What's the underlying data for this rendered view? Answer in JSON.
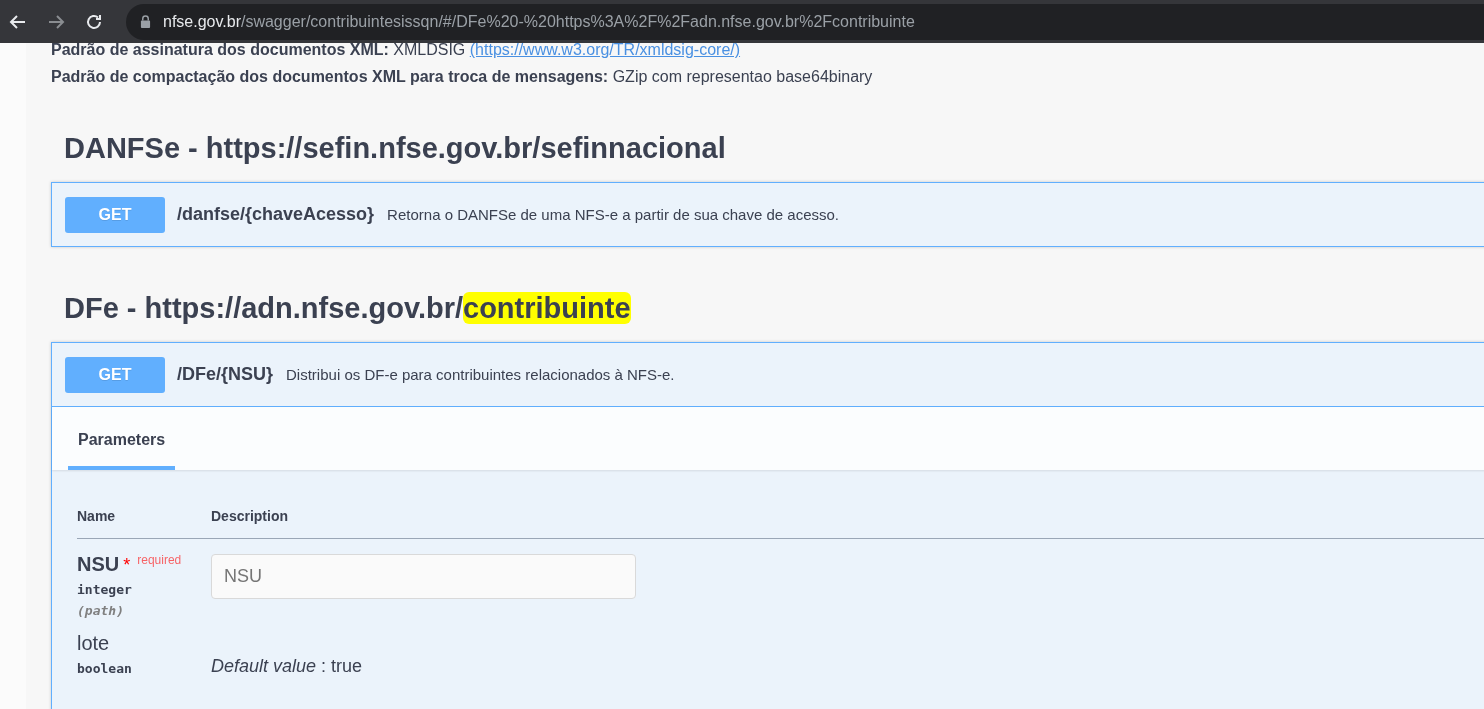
{
  "browser": {
    "url_host": "nfse.gov.br",
    "url_path": "/swagger/contribuintesissqn/#/DFe%20-%20https%3A%2F%2Fadn.nfse.gov.br%2Fcontribuinte"
  },
  "info": [
    {
      "label": "Padrão de assinatura dos documentos XML:",
      "value": "XMLDSIG",
      "link": "(https://www.w3.org/TR/xmldsig-core/)"
    },
    {
      "label": "Padrão de compactação dos documentos XML para troca de mensagens:",
      "value": "GZip com representao base64binary"
    }
  ],
  "sections": [
    {
      "title": "DANFSe - https://sefin.nfse.gov.br/sefinnacional",
      "operations": [
        {
          "method": "GET",
          "path": "/danfse/{chaveAcesso}",
          "summary": "Retorna o DANFSe de uma NFS-e a partir de sua chave de acesso.",
          "expanded": false
        }
      ]
    },
    {
      "title": "DFe - https://adn.nfse.gov.br/",
      "highlight": "contribuinte",
      "operations": [
        {
          "method": "GET",
          "path": "/DFe/{NSU}",
          "summary": "Distribui os DF-e para contribuintes relacionados à NFS-e.",
          "expanded": true,
          "tabs": [
            {
              "label": "Parameters",
              "selected": true
            }
          ],
          "columns": [
            "Name",
            "Description"
          ],
          "parameters": [
            {
              "name": "NSU",
              "required": true,
              "required_mark": "*",
              "required_label": "required",
              "type": "integer",
              "in": "(path)",
              "placeholder": "NSU"
            },
            {
              "name": "lote",
              "required": false,
              "type": "boolean",
              "default_label": "Default value",
              "default_separator": ":",
              "default": "true"
            }
          ]
        }
      ]
    }
  ]
}
